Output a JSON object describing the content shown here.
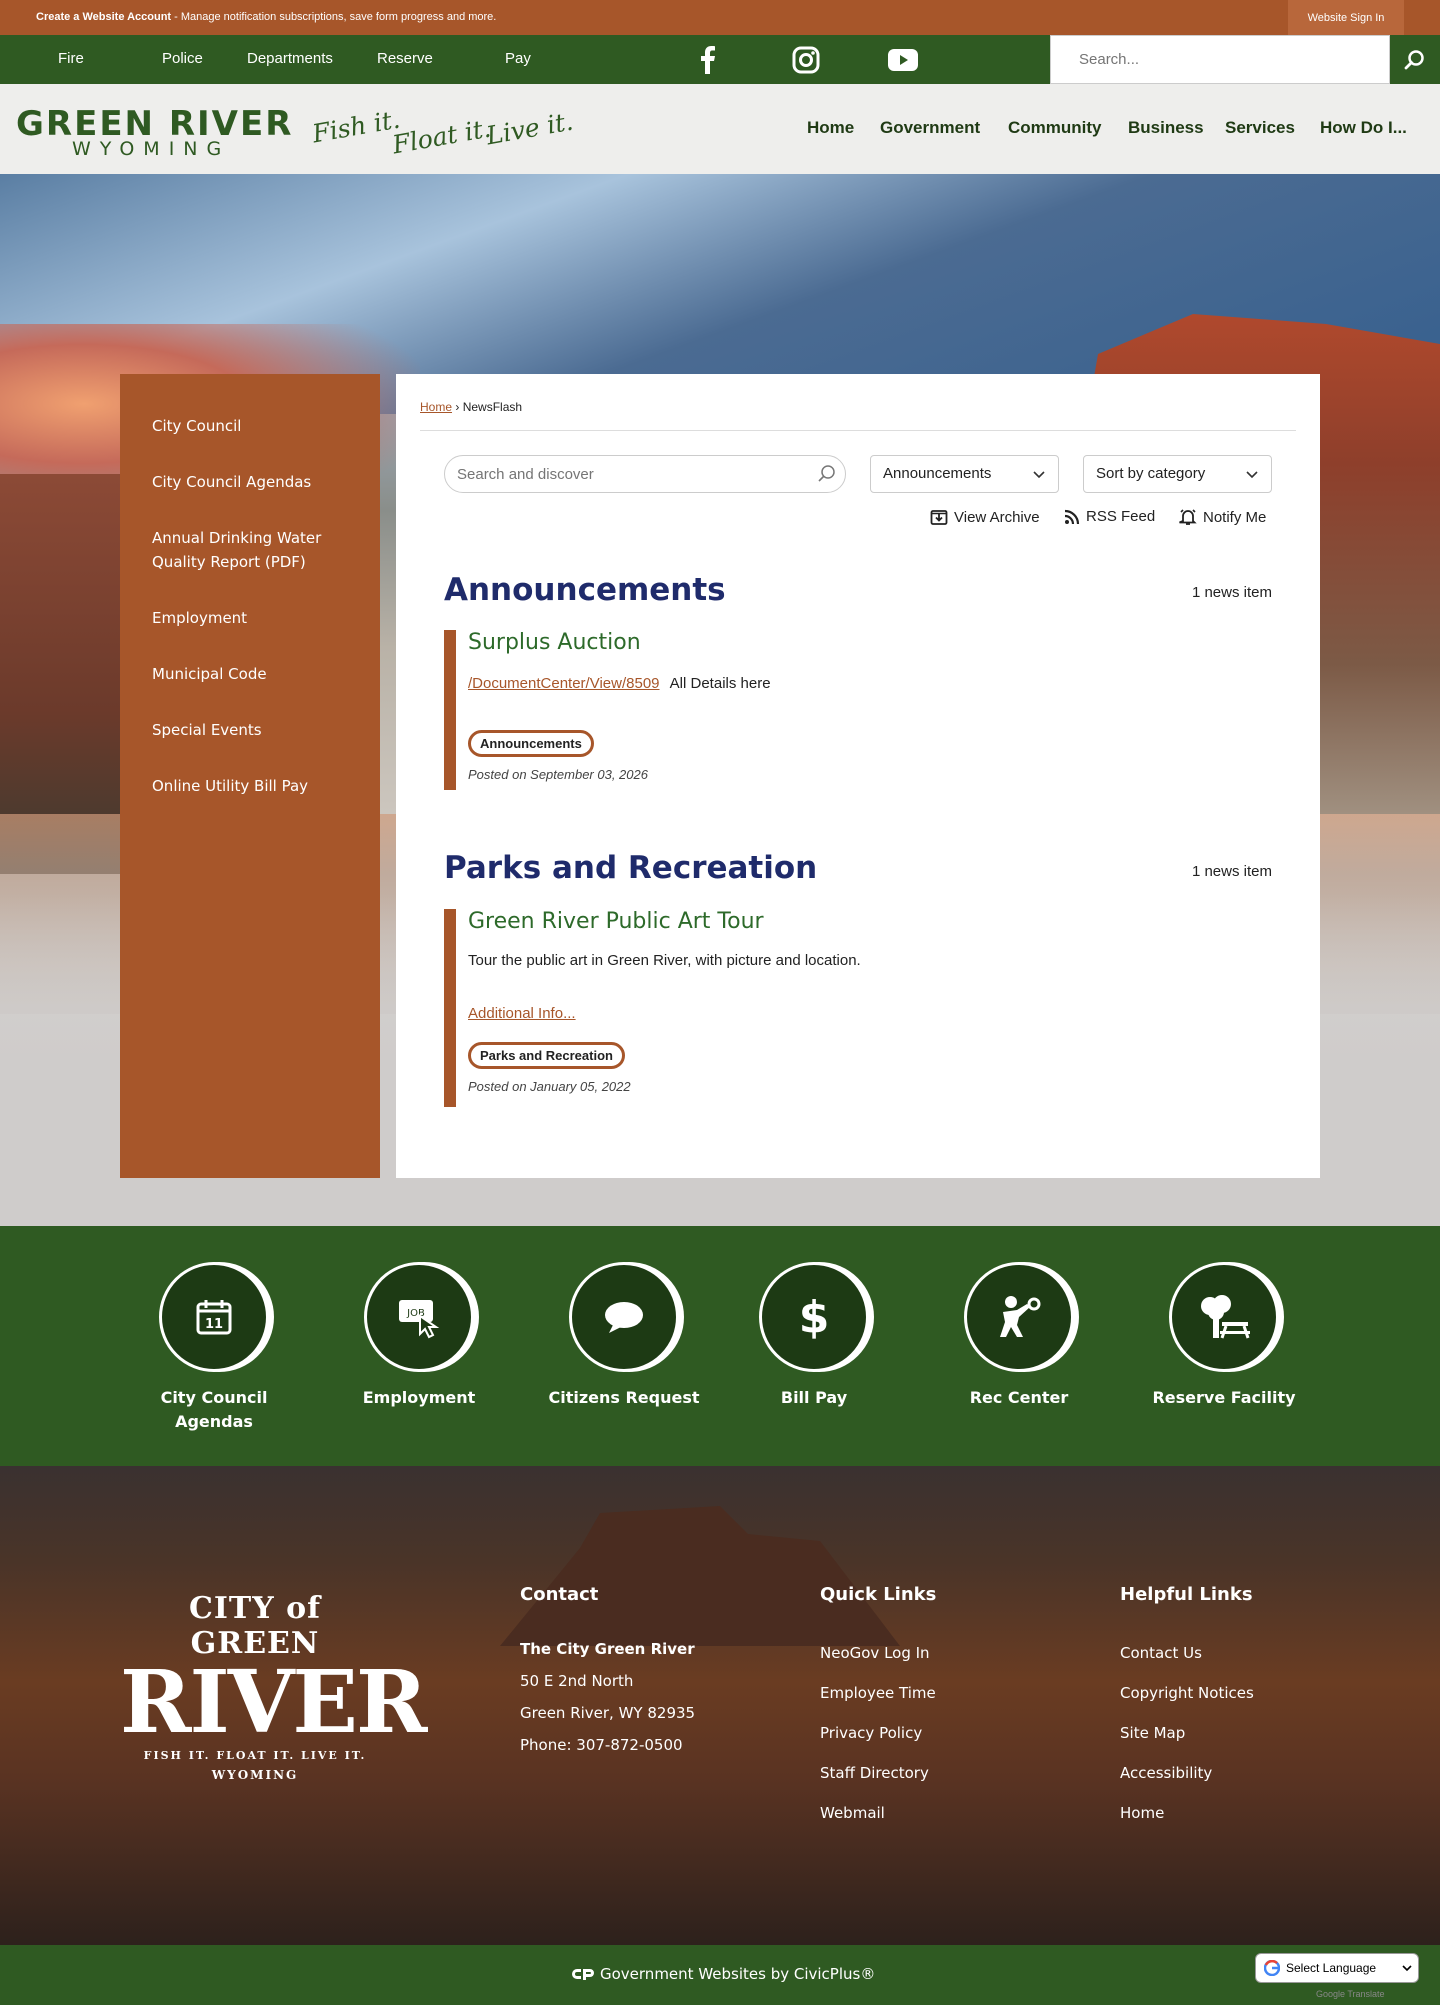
{
  "topbar": {
    "account_link": "Create a Website Account",
    "account_text": " - Manage notification subscriptions, save form progress and more.",
    "sign_in": "Website Sign In"
  },
  "utility_nav": [
    "Fire",
    "Police",
    "Departments",
    "Reserve",
    "Pay"
  ],
  "social_icons": [
    "facebook-icon",
    "instagram-icon",
    "youtube-icon"
  ],
  "search": {
    "placeholder": "Search..."
  },
  "logo": {
    "main": "GREEN RIVER",
    "sub": "WYOMING"
  },
  "tagline": [
    "Fish it.",
    "Float it.",
    "Live it."
  ],
  "main_nav": [
    "Home",
    "Government",
    "Community",
    "Business",
    "Services",
    "How Do I..."
  ],
  "sidebar": [
    "City Council",
    "City Council Agendas",
    "Annual Drinking Water Quality Report (PDF)",
    "Employment",
    "Municipal Code",
    "Special Events",
    "Online Utility Bill Pay"
  ],
  "breadcrumb": {
    "home": "Home",
    "sep": "›",
    "current": "NewsFlash"
  },
  "filters": {
    "search_placeholder": "Search and discover",
    "category": "Announcements",
    "sort": "Sort by category"
  },
  "actions": {
    "archive": "View Archive",
    "rss": "RSS Feed",
    "notify": "Notify Me"
  },
  "categories": [
    {
      "title": "Announcements",
      "count": "1 news item",
      "item": {
        "title": "Surplus Auction",
        "link": "/DocumentCenter/View/8509",
        "text": "All Details here",
        "tag": "Announcements",
        "posted": "Posted on September 03, 2026"
      }
    },
    {
      "title": "Parks and Recreation",
      "count": "1 news item",
      "item": {
        "title": "Green River Public Art Tour",
        "text": "Tour the public art in Green River, with picture and location.",
        "link": "Additional Info...",
        "tag": "Parks and Recreation",
        "posted": "Posted on January 05, 2022"
      }
    }
  ],
  "quick_links": [
    {
      "label": "City Council Agendas",
      "icon": "calendar-icon",
      "icon_text": "11"
    },
    {
      "label": "Employment",
      "icon": "job-cursor-icon",
      "icon_text": "JOB"
    },
    {
      "label": "Citizens Request",
      "icon": "speech-bubble-icon"
    },
    {
      "label": "Bill Pay",
      "icon": "dollar-icon"
    },
    {
      "label": "Rec Center",
      "icon": "weightlifter-icon"
    },
    {
      "label": "Reserve Facility",
      "icon": "picnic-tree-icon"
    }
  ],
  "footer_logo": {
    "line1": "CITY of GREEN",
    "line2": "RIVER",
    "banner": "FISH IT. FLOAT IT. LIVE IT.",
    "state": "WYOMING"
  },
  "contact": {
    "heading": "Contact",
    "name": "The City Green River",
    "address1": "50 E 2nd North",
    "address2": "Green River, WY 82935",
    "phone": "Phone: 307-872-0500"
  },
  "quick_links_footer": {
    "heading": "Quick Links",
    "items": [
      "NeoGov Log In",
      "Employee Time",
      "Privacy Policy",
      "Staff Directory",
      "Webmail"
    ]
  },
  "helpful_links": {
    "heading": "Helpful Links",
    "items": [
      "Contact Us",
      "Copyright Notices",
      "Site Map",
      "Accessibility",
      "Home"
    ]
  },
  "bottom": {
    "credit": "Government Websites by CivicPlus®",
    "language": "Select Language",
    "translate": "Google Translate"
  },
  "colors": {
    "orange": "#a7562a",
    "green": "#2f5a22",
    "title_blue": "#1f2b6b",
    "item_green": "#2d6a2a"
  }
}
